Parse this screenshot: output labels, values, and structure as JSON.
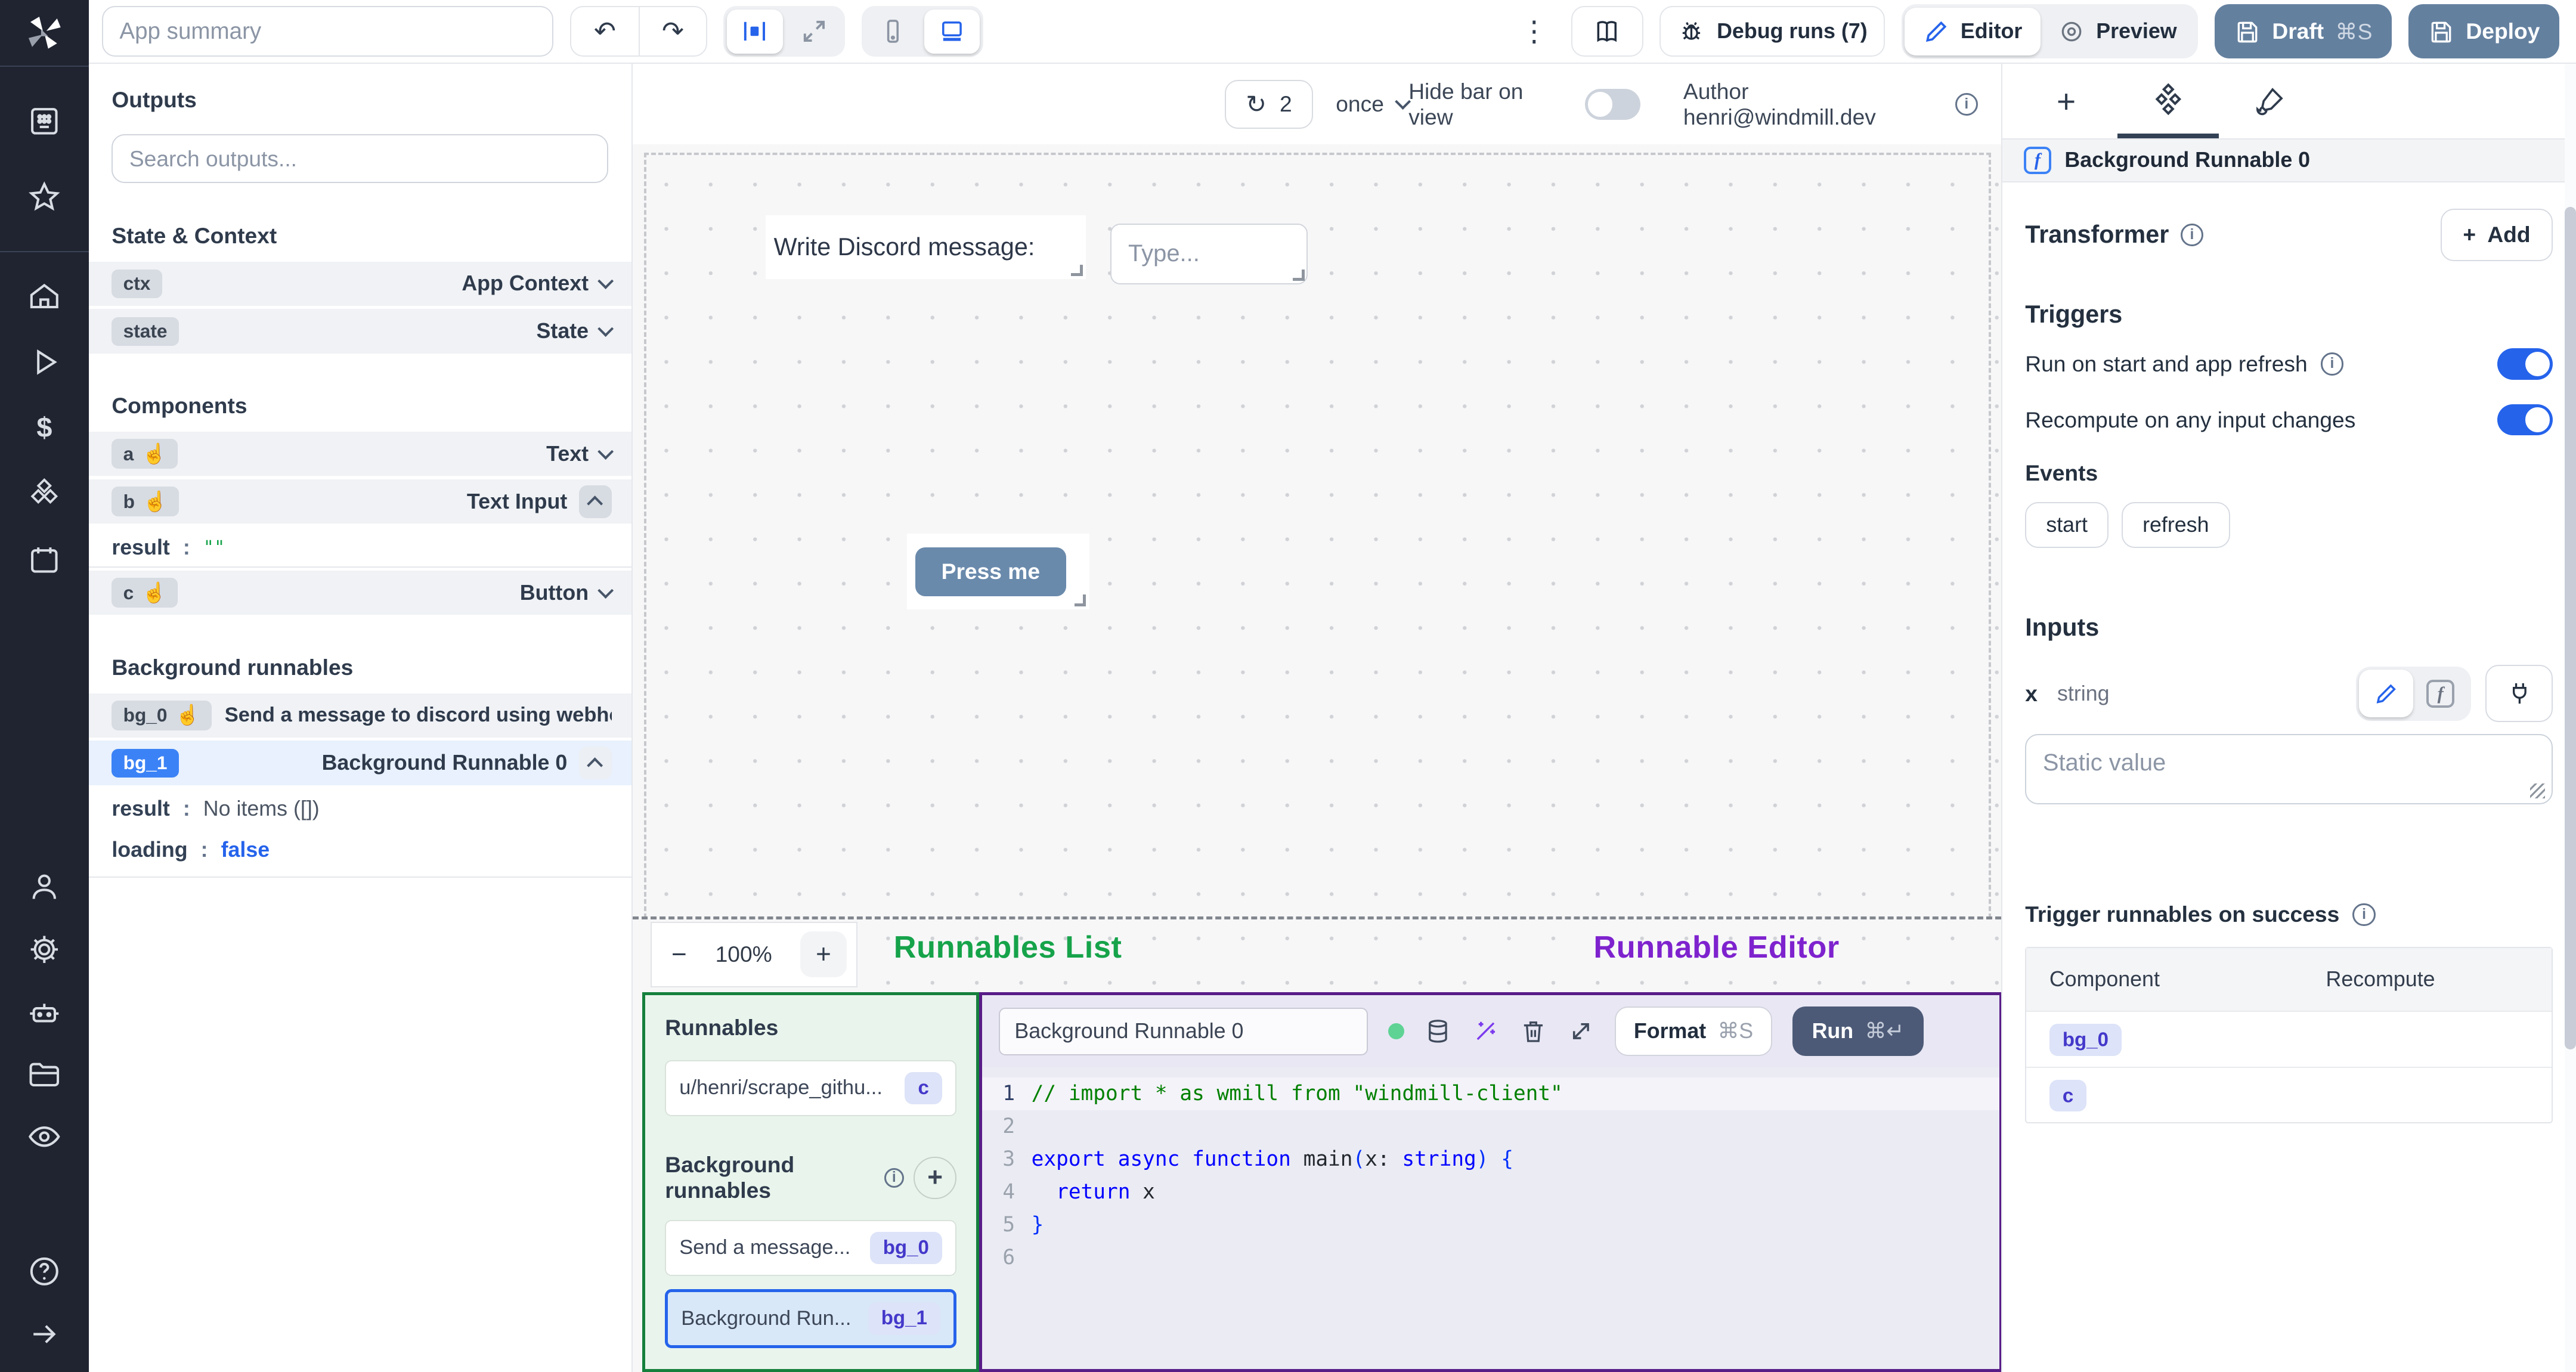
{
  "icons": {
    "undo": "↶",
    "redo": "↷",
    "kebab": "⋮",
    "refresh": "↻",
    "pointer": "☝",
    "plus": "+",
    "minus": "−",
    "info": "i",
    "dollar": "$",
    "question": "?",
    "fn": "f"
  },
  "colors": {
    "accent_blue": "#3b82f6",
    "toggle_on": "#2563eb",
    "slate_button": "#64809f",
    "run_button": "#4c5a77",
    "green_label": "#16a34a",
    "purple_label": "#7e22ce",
    "badge_indigo": "#4338ca",
    "rail_bg": "#1f2430"
  },
  "topbar": {
    "summary_placeholder": "App summary",
    "debug_label": "Debug runs (7)",
    "editor_label": "Editor",
    "preview_label": "Preview",
    "draft_label": "Draft",
    "draft_kbd": "⌘S",
    "deploy_label": "Deploy"
  },
  "outputs": {
    "title": "Outputs",
    "search_placeholder": "Search outputs...",
    "state_context_title": "State & Context",
    "ctx_id": "ctx",
    "ctx_type": "App Context",
    "state_id": "state",
    "state_type": "State",
    "components_title": "Components",
    "a_id": "a",
    "a_type": "Text",
    "b_id": "b",
    "b_type": "Text Input",
    "b_result_key": "result",
    "b_result_value": "\"\"",
    "c_id": "c",
    "c_type": "Button",
    "bg_title": "Background runnables",
    "bg0_id": "bg_0",
    "bg0_label": "Send a message to discord using webhoo",
    "bg1_id": "bg_1",
    "bg1_label": "Background Runnable 0",
    "bg1_result_key": "result",
    "bg1_result_value": "No items ([])",
    "bg1_loading_key": "loading",
    "bg1_loading_value": "false"
  },
  "canvas": {
    "refresh_count": "2",
    "mode": "once",
    "hide_bar_label": "Hide bar on view",
    "author_label": "Author henri@windmill.dev",
    "text_component": "Write Discord message:",
    "input_placeholder": "Type...",
    "button_label": "Press me",
    "zoom_level": "100%",
    "runnables_list_label": "Runnables List",
    "runnable_editor_label": "Runnable Editor"
  },
  "runnables": {
    "title": "Runnables",
    "script_label": "u/henri/scrape_githu...",
    "script_badge": "c",
    "bg_title": "Background runnables",
    "bg0_label": "Send a message...",
    "bg0_badge": "bg_0",
    "bg1_label": "Background Run...",
    "bg1_badge": "bg_1"
  },
  "editor": {
    "name": "Background Runnable 0",
    "format_label": "Format",
    "format_kbd": "⌘S",
    "run_label": "Run",
    "run_kbd": "⌘↵",
    "ln": [
      "1",
      "2",
      "3",
      "4",
      "5",
      "6"
    ],
    "code": {
      "l1": "// import * as wmill from \"windmill-client\"",
      "l3_kw": "export async function ",
      "l3_name": "main",
      "l3_p1": "(",
      "l3_param": "x",
      "l3_colon": ": ",
      "l3_type": "string",
      "l3_p2": ") {",
      "l4_kw": "  return",
      "l4_id": " x",
      "l5": "}"
    }
  },
  "right": {
    "component_title": "Background Runnable 0",
    "transformer_label": "Transformer",
    "add_label": "Add",
    "triggers_title": "Triggers",
    "trigger1": "Run on start and app refresh",
    "trigger2": "Recompute on any input changes",
    "events_label": "Events",
    "event1": "start",
    "event2": "refresh",
    "inputs_title": "Inputs",
    "input_name": "x",
    "input_type": "string",
    "static_placeholder": "Static value",
    "success_title": "Trigger runnables on success",
    "col_component": "Component",
    "col_recompute": "Recompute",
    "row1_badge": "bg_0",
    "row2_badge": "c"
  }
}
